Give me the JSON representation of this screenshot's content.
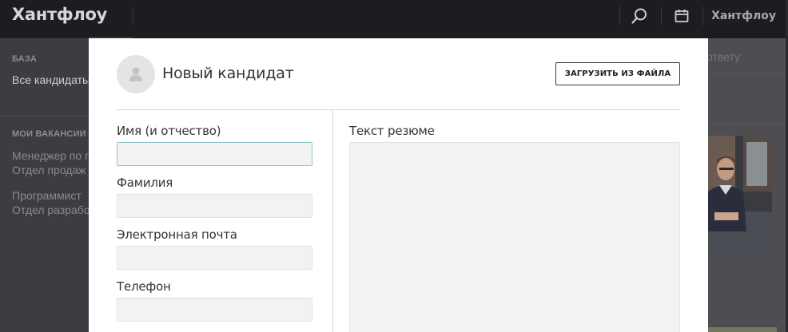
{
  "app": {
    "logo": "Хантфлоу",
    "user_name": "Хантфлоу"
  },
  "icons": {
    "search": "search-icon",
    "calendar": "calendar-icon",
    "avatar": "person-icon"
  },
  "sidebar": {
    "base_title": "БАЗА",
    "all_candidates": "Все кандидаты",
    "vacancies_title": "МОИ ВАКАНСИИ",
    "vacancies": [
      {
        "title": "Менеджер по продажам",
        "department": "Отдел продаж"
      },
      {
        "title": "Программист",
        "department": "Отдел разработки"
      }
    ]
  },
  "background": {
    "hint_text": "к ответу"
  },
  "modal": {
    "title": "Новый кандидат",
    "upload_button": "ЗАГРУЗИТЬ ИЗ ФАЙЛА",
    "fields": {
      "first_name_label": "Имя (и отчество)",
      "first_name_value": "",
      "last_name_label": "Фамилия",
      "last_name_value": "",
      "email_label": "Электронная почта",
      "email_value": "",
      "phone_label": "Телефон",
      "phone_value": "",
      "resume_label": "Текст резюме",
      "resume_value": ""
    }
  },
  "colors": {
    "topbar": "#1e1c21",
    "overlay_bg": "#4a4a4e",
    "focus_border": "#8fc6ca",
    "input_bg": "#f2f2f2"
  }
}
